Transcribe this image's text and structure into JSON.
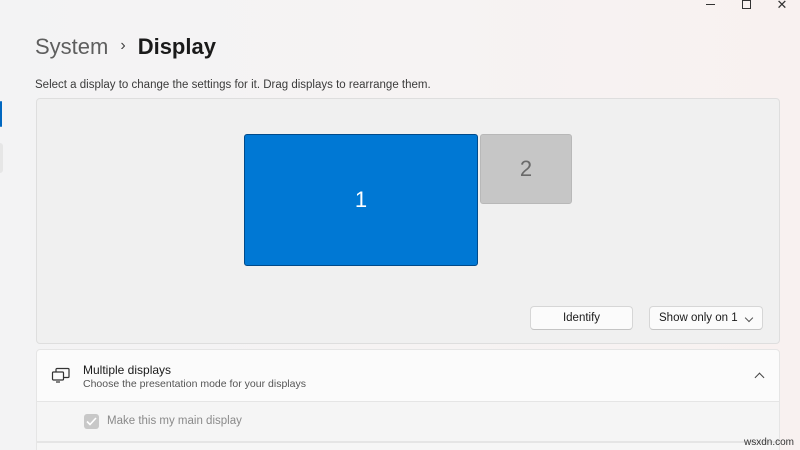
{
  "window": {
    "minimize_icon": "minimize-icon",
    "maximize_icon": "maximize-icon",
    "close_glyph": "✕"
  },
  "header": {
    "parent": "System",
    "separator": "›",
    "current": "Display",
    "description": "Select a display to change the settings for it. Drag displays to rearrange them."
  },
  "arrangement": {
    "monitors": [
      {
        "label": "1",
        "selected": true,
        "color": "#0078d4"
      },
      {
        "label": "2",
        "selected": false,
        "color": "#c6c6c6"
      }
    ],
    "identify_label": "Identify",
    "mode_select": {
      "value": "Show only on 1"
    }
  },
  "multiple_displays": {
    "title": "Multiple displays",
    "subtitle": "Choose the presentation mode for your displays",
    "expanded": true,
    "main_display": {
      "label": "Make this my main display",
      "checked": true,
      "disabled": true
    }
  },
  "watermark": "wsxdn.com",
  "colors": {
    "accent": "#0067c0",
    "monitor_selected": "#0078d4"
  }
}
